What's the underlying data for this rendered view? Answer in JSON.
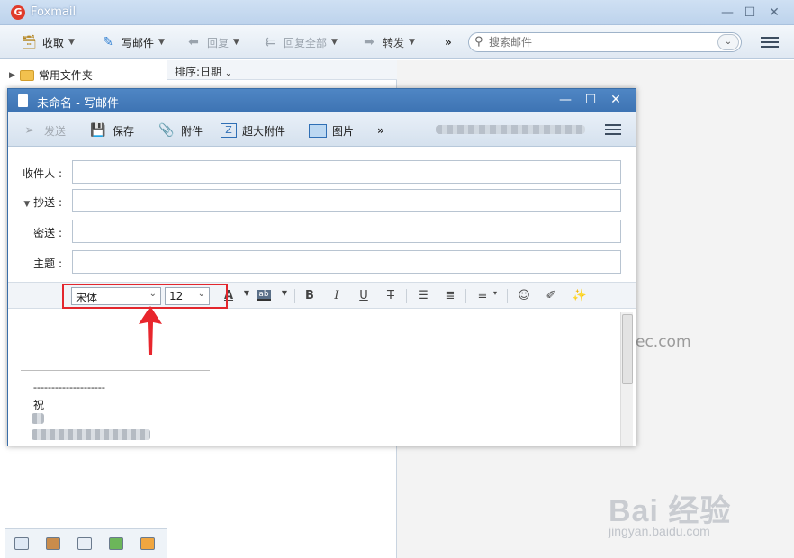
{
  "app": {
    "title": "Foxmail"
  },
  "main_toolbar": {
    "receive": "收取",
    "compose": "写邮件",
    "reply": "回复",
    "reply_all": "回复全部",
    "forward": "转发",
    "more": "»"
  },
  "search": {
    "placeholder": "搜索邮件"
  },
  "folders": [
    {
      "label": "常用文件夹"
    }
  ],
  "mail_list": {
    "sort_label": "排序:日期"
  },
  "reading_pane": {
    "watermark_text": "ec.com"
  },
  "compose": {
    "title": "未命名 - 写邮件",
    "toolbar": {
      "send": "发送",
      "save": "保存",
      "attach": "附件",
      "large_attach": "超大附件",
      "image": "图片",
      "more": "»"
    },
    "fields": {
      "to_label": "收件人 :",
      "cc_label": "抄送 :",
      "bcc_label": "密送 :",
      "subject_label": "主题 :"
    },
    "format": {
      "font": "宋体",
      "size": "12"
    },
    "body": {
      "dashes": "--------------------",
      "greeting": "祝"
    }
  },
  "watermark": {
    "brand": "Bai 经验",
    "url": "jingyan.baidu.com"
  },
  "colors": {
    "title_blue": "#3d73b3",
    "highlight_red": "#e3262d"
  }
}
